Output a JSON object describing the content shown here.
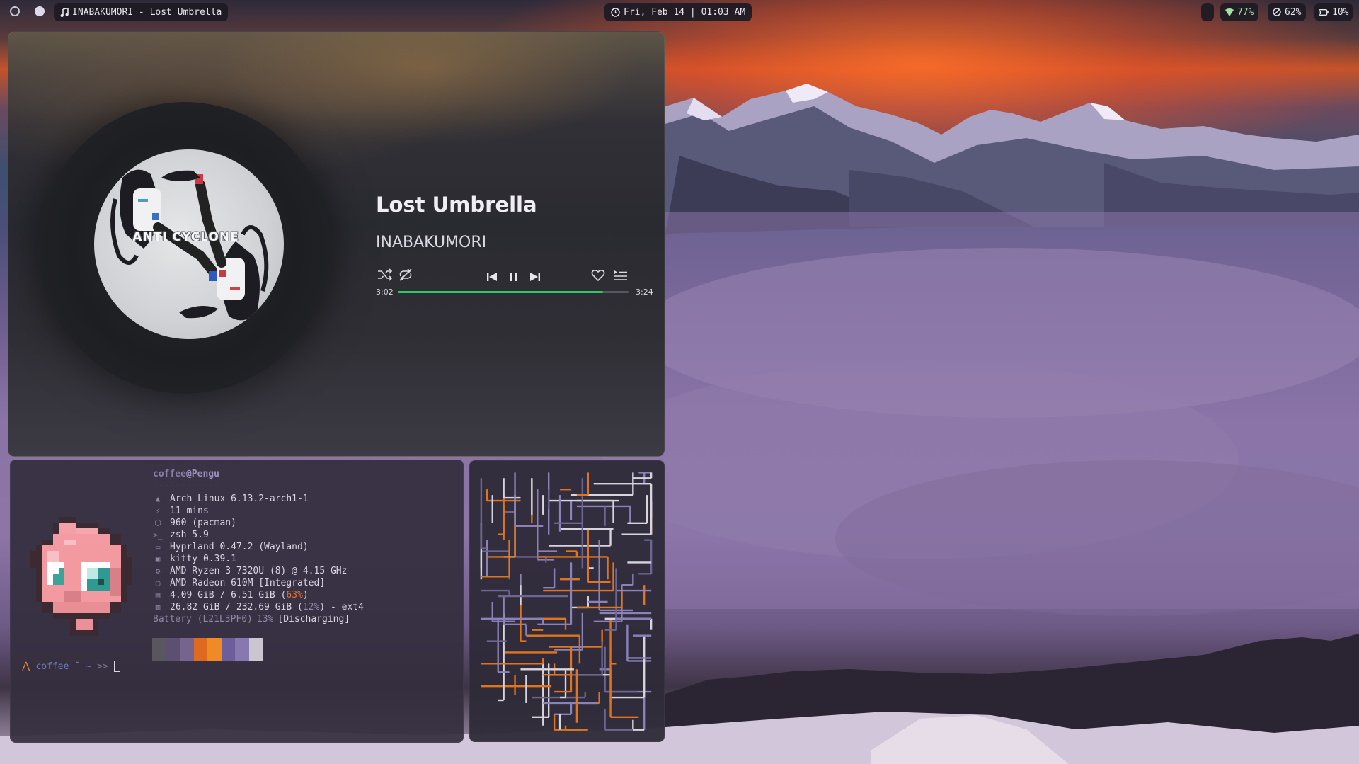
{
  "topbar": {
    "workspaces": [
      "workspace-1",
      "workspace-2"
    ],
    "window_title": "INABAKUMORI - Lost Umbrella",
    "clock": "Fri, Feb 14 | 01:03 AM",
    "wifi": "77%",
    "brightness": "62%",
    "battery": "10%"
  },
  "player": {
    "title": "Lost Umbrella",
    "artist": "INABAKUMORI",
    "cover_text": "ANTI CYCLONE",
    "elapsed": "3:02",
    "total": "3:24",
    "progress": 0.89,
    "accent": "#2ec868"
  },
  "terminal": {
    "user": "coffee",
    "at": "@",
    "host": "Pengu",
    "separator": "------------",
    "lines": [
      {
        "icon": "arch-icon",
        "glyph": "▲",
        "text": "Arch Linux 6.13.2-arch1-1"
      },
      {
        "icon": "bolt-icon",
        "glyph": "⚡",
        "text": "11 mins"
      },
      {
        "icon": "package-icon",
        "glyph": "⬡",
        "text": "960 (pacman)"
      },
      {
        "icon": "shell-icon",
        "glyph": ">_",
        "text": "zsh 5.9"
      },
      {
        "icon": "window-icon",
        "glyph": "▭",
        "text": "Hyprland 0.47.2 (Wayland)"
      },
      {
        "icon": "terminal-icon",
        "glyph": "▣",
        "text": "kitty 0.39.1"
      },
      {
        "icon": "cpu-icon",
        "glyph": "⚙",
        "text": "AMD Ryzen 3 7320U (8) @ 4.15 GHz"
      },
      {
        "icon": "gpu-icon",
        "glyph": "▢",
        "text": "AMD Radeon 610M [Integrated]"
      }
    ],
    "memory": {
      "pre": "4.09 GiB / 6.51 GiB (",
      "pct": "63%",
      "post": ")"
    },
    "disk": {
      "pre": "26.82 GiB / 232.69 GiB (",
      "pct": "12%",
      "post": ") - ext4"
    },
    "battery": {
      "label": "Battery (L21L3PF0)",
      "pct": "13%",
      "state": "[Discharging]"
    },
    "palette": [
      "#58565f",
      "#5c4f6f",
      "#75648e",
      "#dd6a1f",
      "#f08a24",
      "#6b5e9a",
      "#8778b0",
      "#c9c6cf"
    ],
    "prompt": {
      "user": "coffee",
      "tilde": "˜",
      "path": "~",
      "arrows": ">>"
    }
  },
  "colors": {
    "bar_bg": "#1c1a24",
    "wifi_green": "#a6e3a1",
    "pipe_orange": "#e0741f",
    "pipe_lavender": "#8a82b8",
    "pipe_white": "#d7d4de"
  }
}
